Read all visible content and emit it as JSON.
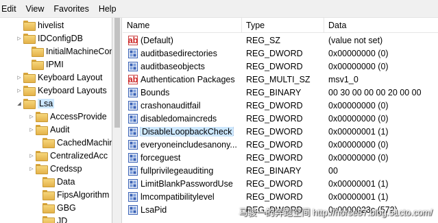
{
  "menu": [
    "Edit",
    "View",
    "Favorites",
    "Help"
  ],
  "tree": [
    {
      "label": "hivelist",
      "expander": ""
    },
    {
      "label": "IDConfigDB",
      "expander": "▷"
    },
    {
      "label": "InitialMachineCon",
      "expander": ""
    },
    {
      "label": "IPMI",
      "expander": ""
    },
    {
      "label": "Keyboard Layout",
      "expander": "▷"
    },
    {
      "label": "Keyboard Layouts",
      "expander": "▷"
    },
    {
      "label": "Lsa",
      "expander": "◢",
      "selected": true
    },
    {
      "label": "AccessProvide",
      "expander": "▷"
    },
    {
      "label": "Audit",
      "expander": "▷"
    },
    {
      "label": "CachedMachin",
      "expander": ""
    },
    {
      "label": "CentralizedAcc",
      "expander": "▷"
    },
    {
      "label": "Credssp",
      "expander": "▷"
    },
    {
      "label": "Data",
      "expander": ""
    },
    {
      "label": "FipsAlgorithm",
      "expander": ""
    },
    {
      "label": "GBG",
      "expander": ""
    },
    {
      "label": "JD",
      "expander": ""
    }
  ],
  "columns": {
    "name": "Name",
    "type": "Type",
    "data": "Data"
  },
  "values": [
    {
      "name": "(Default)",
      "type": "REG_SZ",
      "data": "(value not set)",
      "icon": "string-value-icon",
      "glyph": "ab"
    },
    {
      "name": "auditbasedirectories",
      "type": "REG_DWORD",
      "data": "0x00000000 (0)",
      "icon": "binary-value-icon",
      "glyph": "011"
    },
    {
      "name": "auditbaseobjects",
      "type": "REG_DWORD",
      "data": "0x00000000 (0)",
      "icon": "binary-value-icon",
      "glyph": "011"
    },
    {
      "name": "Authentication Packages",
      "type": "REG_MULTI_SZ",
      "data": "msv1_0",
      "icon": "string-value-icon",
      "glyph": "ab"
    },
    {
      "name": "Bounds",
      "type": "REG_BINARY",
      "data": "00 30 00 00 00 20 00 00",
      "icon": "binary-value-icon",
      "glyph": "011"
    },
    {
      "name": "crashonauditfail",
      "type": "REG_DWORD",
      "data": "0x00000000 (0)",
      "icon": "binary-value-icon",
      "glyph": "011"
    },
    {
      "name": "disabledomaincreds",
      "type": "REG_DWORD",
      "data": "0x00000000 (0)",
      "icon": "binary-value-icon",
      "glyph": "011"
    },
    {
      "name": "DisableLoopbackCheck",
      "type": "REG_DWORD",
      "data": "0x00000001 (1)",
      "icon": "binary-value-icon",
      "glyph": "011",
      "selected": true
    },
    {
      "name": "everyoneincludesanony...",
      "type": "REG_DWORD",
      "data": "0x00000000 (0)",
      "icon": "binary-value-icon",
      "glyph": "011"
    },
    {
      "name": "forceguest",
      "type": "REG_DWORD",
      "data": "0x00000000 (0)",
      "icon": "binary-value-icon",
      "glyph": "011"
    },
    {
      "name": "fullprivilegeauditing",
      "type": "REG_BINARY",
      "data": "00",
      "icon": "binary-value-icon",
      "glyph": "011"
    },
    {
      "name": "LimitBlankPasswordUse",
      "type": "REG_DWORD",
      "data": "0x00000001 (1)",
      "icon": "binary-value-icon",
      "glyph": "011"
    },
    {
      "name": "lmcompatibilitylevel",
      "type": "REG_DWORD",
      "data": "0x00000001 (1)",
      "icon": "binary-value-icon",
      "glyph": "011"
    },
    {
      "name": "LsaPid",
      "type": "REG_DWORD",
      "data": "0x0000023c (572)",
      "icon": "binary-value-icon",
      "glyph": "011"
    }
  ],
  "watermark": "马骏一的奔跑空间 http://horse87.blog.51cto.com/",
  "colors": {
    "selection": "#cde8ff",
    "folder": "#f6d67c"
  }
}
